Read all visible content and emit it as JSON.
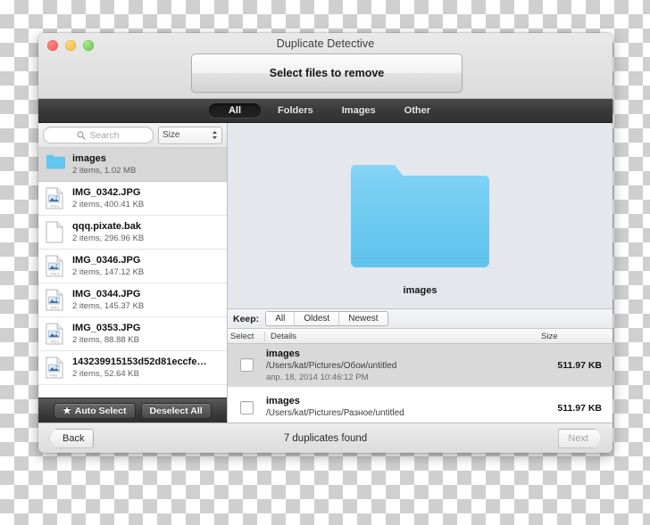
{
  "window": {
    "title": "Duplicate Detective",
    "traffic_lights": [
      "close",
      "minimize",
      "zoom"
    ],
    "header_button_label": "Select files to remove"
  },
  "tabs": [
    {
      "label": "All",
      "active": true
    },
    {
      "label": "Folders",
      "active": false
    },
    {
      "label": "Images",
      "active": false
    },
    {
      "label": "Other",
      "active": false
    }
  ],
  "sidebar": {
    "search": {
      "placeholder": "Search",
      "value": "",
      "icon": "search-icon"
    },
    "sort": {
      "label": "Size",
      "icon": "updown-chevron-icon"
    },
    "files": [
      {
        "name": "images",
        "meta": "2 items, 1.02 MB",
        "icon": "folder-icon",
        "selected": true
      },
      {
        "name": "IMG_0342.JPG",
        "meta": "2 items, 400.41 KB",
        "icon": "jpeg-file-icon",
        "selected": false
      },
      {
        "name": "qqq.pixate.bak",
        "meta": "2 items, 296.96 KB",
        "icon": "blank-file-icon",
        "selected": false
      },
      {
        "name": "IMG_0346.JPG",
        "meta": "2 items, 147.12 KB",
        "icon": "jpeg-file-icon",
        "selected": false
      },
      {
        "name": "IMG_0344.JPG",
        "meta": "2 items, 145.37 KB",
        "icon": "jpeg-file-icon",
        "selected": false
      },
      {
        "name": "IMG_0353.JPG",
        "meta": "2 items, 88.88 KB",
        "icon": "jpeg-file-icon",
        "selected": false
      },
      {
        "name": "143239915153d52d81eccfe…",
        "meta": "2 items, 52.64 KB",
        "icon": "jpeg-file-icon",
        "selected": false
      }
    ],
    "auto_select_label": "Auto Select",
    "auto_select_icon": "star-icon",
    "deselect_all_label": "Deselect All"
  },
  "preview": {
    "icon": "folder-icon-large",
    "caption": "images"
  },
  "keep": {
    "label": "Keep:",
    "options": [
      {
        "label": "All",
        "active": true
      },
      {
        "label": "Oldest",
        "active": false
      },
      {
        "label": "Newest",
        "active": false
      }
    ]
  },
  "duplicates_table": {
    "columns": [
      "Select",
      "Details",
      "Size"
    ],
    "rows": [
      {
        "checked": false,
        "title": "images",
        "path": "/Users/kat/Pictures/Обои/untitled",
        "date": "апр. 18, 2014 10:46:12 PM",
        "size": "511.97 KB",
        "selected": true
      },
      {
        "checked": false,
        "title": "images",
        "path": "/Users/kat/Pictures/Разное/untitled",
        "date": "",
        "size": "511.97 KB",
        "selected": false
      }
    ]
  },
  "footer": {
    "back_label": "Back",
    "status": "7 duplicates found",
    "next_label": "Next"
  },
  "colors": {
    "folder_blue": "#62c6ee",
    "tabbar_dark": "#3a3a3a",
    "selected_row": "#d7d7d7",
    "preview_bg": "#e4e7ec"
  }
}
